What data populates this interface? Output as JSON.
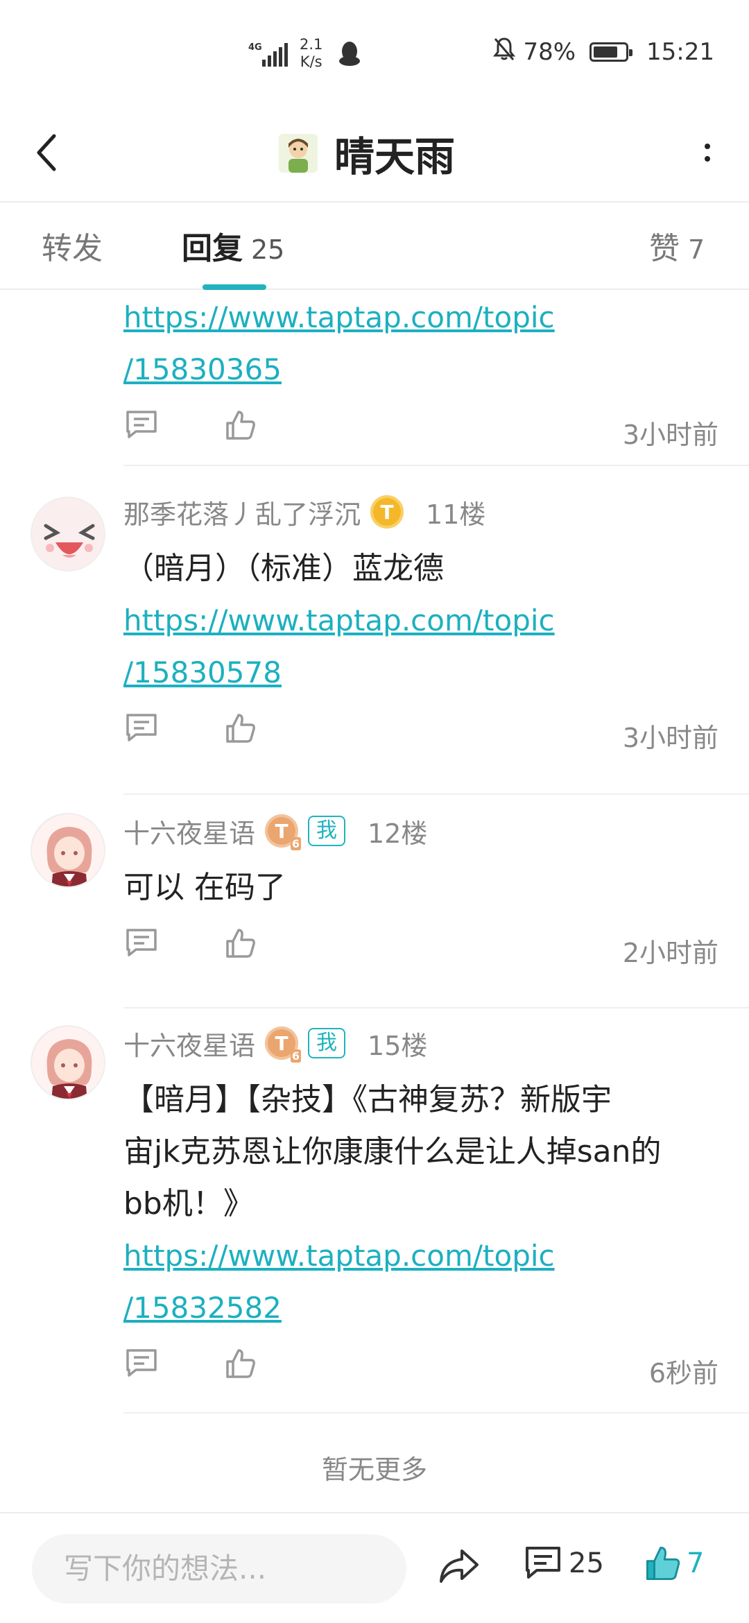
{
  "status_bar": {
    "network": "4G",
    "speed_value": "2.1",
    "speed_unit": "K/s",
    "battery": "78%",
    "battery_level": 0.78,
    "time": "15:21"
  },
  "header": {
    "title": "晴天雨"
  },
  "tabs": [
    {
      "label": "转发",
      "count": ""
    },
    {
      "label": "回复",
      "count": "25"
    },
    {
      "label": "赞",
      "count": "7"
    }
  ],
  "top_reply": {
    "link_line1": "https://www.taptap.com/topic",
    "link_line2": "/15830365",
    "time": "3小时前"
  },
  "replies": [
    {
      "username": "那季花落丿乱了浮沉",
      "level_letter": "T",
      "level_num": "",
      "floor": "11楼",
      "text": "（暗月）（标准）蓝龙德",
      "link_line1": "https://www.taptap.com/topic",
      "link_line2": "/15830578",
      "time": "3小时前"
    },
    {
      "username": "十六夜星语",
      "level_letter": "T",
      "level_num": "6",
      "me_badge": "我",
      "floor": "12楼",
      "text": "可以 在码了",
      "time": "2小时前"
    },
    {
      "username": "十六夜星语",
      "level_letter": "T",
      "level_num": "6",
      "me_badge": "我",
      "floor": "15楼",
      "text_line1": "【暗月】【杂技】《古神复苏？新版宇",
      "text_line2": "宙jk克苏恩让你康康什么是让人掉san的",
      "text_line3": "bb机！》",
      "link_line1": "https://www.taptap.com/topic",
      "link_line2": "/15832582",
      "time": "6秒前"
    }
  ],
  "no_more": "暂无更多",
  "bottom_bar": {
    "input_placeholder": "写下你的想法...",
    "comment_count": "25",
    "like_count": "7"
  },
  "colors": {
    "accent": "#1fb3bf",
    "link": "#1cb0c0"
  }
}
